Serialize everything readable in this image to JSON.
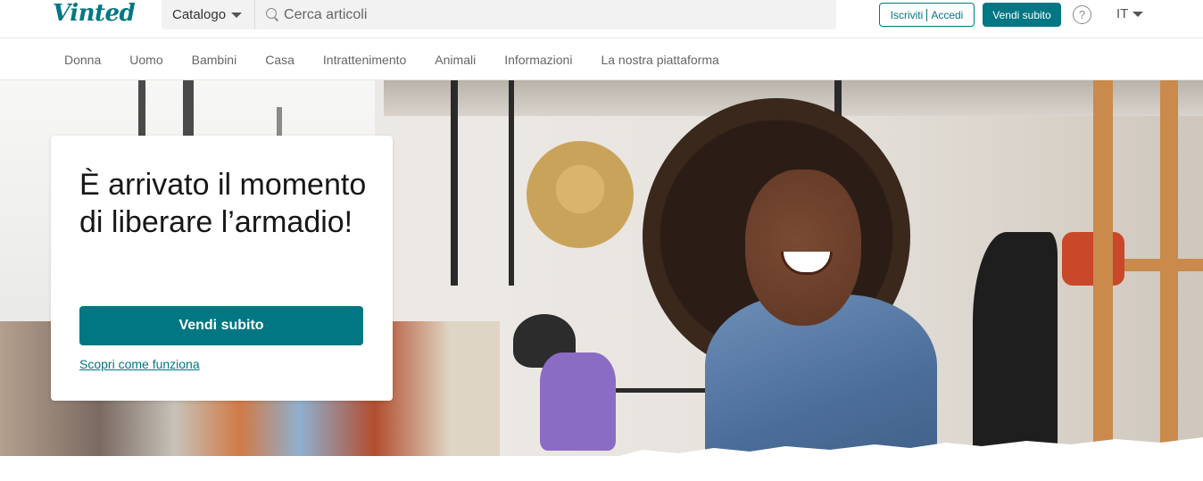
{
  "header": {
    "logo_text": "Vinted",
    "catalog_label": "Catalogo",
    "search_placeholder": "Cerca articoli",
    "auth_signup": "Iscriviti",
    "auth_login": "Accedi",
    "sell_label": "Vendi subito",
    "help_glyph": "?",
    "language": "IT"
  },
  "nav": {
    "items": [
      {
        "label": "Donna"
      },
      {
        "label": "Uomo"
      },
      {
        "label": "Bambini"
      },
      {
        "label": "Casa"
      },
      {
        "label": "Intrattenimento"
      },
      {
        "label": "Animali"
      },
      {
        "label": "Informazioni"
      },
      {
        "label": "La nostra piattaforma"
      }
    ]
  },
  "hero": {
    "title": "È arrivato il momento di liberare l’armadio!",
    "cta_label": "Vendi subito",
    "link_label": "Scopri come funziona"
  },
  "colors": {
    "brand": "#007782"
  },
  "icons": [
    "search-icon",
    "chevron-down-icon",
    "help-icon"
  ]
}
